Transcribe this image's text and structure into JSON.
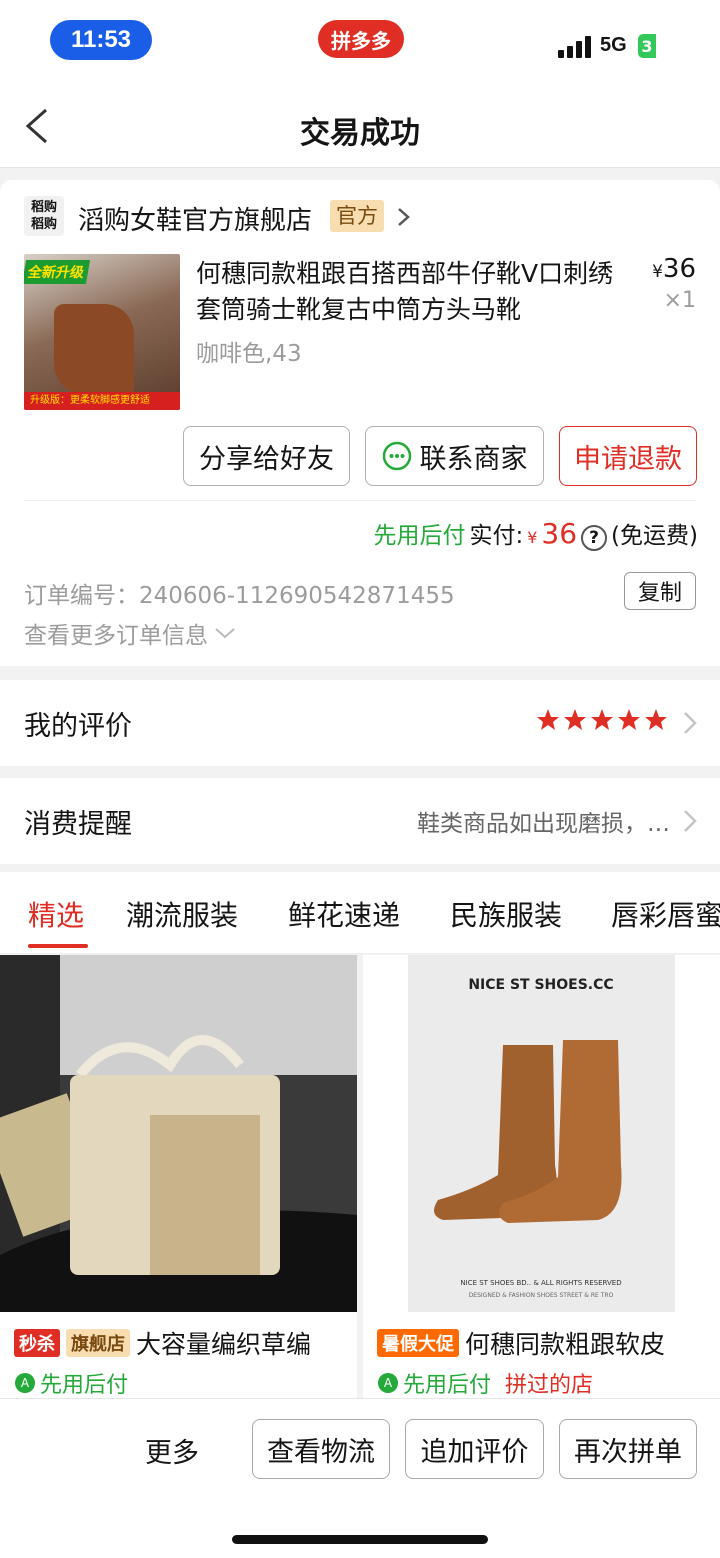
{
  "status": {
    "time": "11:53",
    "app": "拼多多",
    "network": "5G",
    "battery": "3"
  },
  "nav": {
    "title": "交易成功"
  },
  "store": {
    "logo_text": "稻购\n稻购",
    "name": "滔购女鞋官方旗舰店",
    "badge": "官方"
  },
  "product": {
    "thumb_tag": "全新升级",
    "thumb_strip": "升级版：更柔软脚感更舒适",
    "title": "何穗同款粗跟百搭西部牛仔靴V口刺绣套筒骑士靴复古中筒方头马靴",
    "currency": "¥",
    "price": "36",
    "qty": "×1",
    "variant": "咖啡色,43"
  },
  "actions": {
    "share": "分享给好友",
    "contact": "联系商家",
    "refund": "申请退款"
  },
  "payment": {
    "pay_later": "先用后付",
    "label": "实付:",
    "currency": "¥",
    "amount": "36",
    "help_icon": "?",
    "shipping": "(免运费)"
  },
  "order": {
    "number": "订单编号：240606-112690542871455",
    "copy": "复制",
    "more": "查看更多订单信息"
  },
  "review": {
    "label": "我的评价",
    "rating": 5
  },
  "reminder": {
    "label": "消费提醒",
    "text": "鞋类商品如出现磨损，…"
  },
  "tabs": [
    "精选",
    "潮流服装",
    "鲜花速递",
    "民族服装",
    "唇彩唇蜜"
  ],
  "recommend": [
    {
      "badges": [
        "秒杀",
        "旗舰店"
      ],
      "title": "大容量编织草编",
      "sub": "先用后付",
      "extra": ""
    },
    {
      "badges": [
        "暑假大促"
      ],
      "title": "何穗同款粗跟软皮",
      "sub": "先用后付",
      "extra": "拼过的店",
      "image_text": "NICE ST SHOES.CC",
      "image_footer": "NICE ST SHOES BD.. & ALL RIGHTS RESERVED",
      "image_footer2": "DESIGNED & FASHION SHOES STREET & RE TRO"
    }
  ],
  "bottom": {
    "more": "更多",
    "logistics": "查看物流",
    "add_review": "追加评价",
    "reorder": "再次拼单"
  },
  "colors": {
    "brand_red": "#e02e24",
    "pay_green": "#25a93a",
    "time_blue": "#1a5ee8"
  }
}
